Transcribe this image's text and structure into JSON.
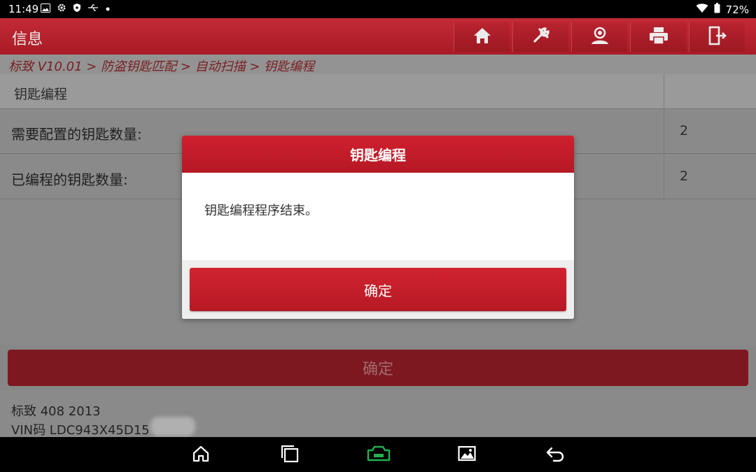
{
  "status_bar": {
    "time": "11:49",
    "battery": "72%",
    "icons": [
      "image-icon",
      "gear-icon",
      "shield-icon",
      "usb-icon",
      "dot-icon",
      "wifi-icon",
      "battery-icon"
    ]
  },
  "header": {
    "title": "信息",
    "toolbar": [
      "home-icon",
      "tools-icon",
      "person-icon",
      "print-icon",
      "exit-icon"
    ]
  },
  "breadcrumb": "标致 V10.01 > 防盗钥匙匹配 > 自动扫描 > 钥匙编程",
  "table": {
    "header": "钥匙编程",
    "rows": [
      {
        "label": "需要配置的钥匙数量:",
        "value": "2"
      },
      {
        "label": "已编程的钥匙数量:",
        "value": "2"
      }
    ]
  },
  "bottom_button": "确定",
  "vehicle": {
    "model": "标致 408 2013",
    "vin": "VIN码 LDC943X45D15"
  },
  "dialog": {
    "title": "钥匙编程",
    "message": "钥匙编程程序结束。",
    "ok": "确定"
  },
  "colors": {
    "brand_red": "#c32a36",
    "dialog_button": "#c81e2b",
    "nav_vci_green": "#23b14d"
  }
}
